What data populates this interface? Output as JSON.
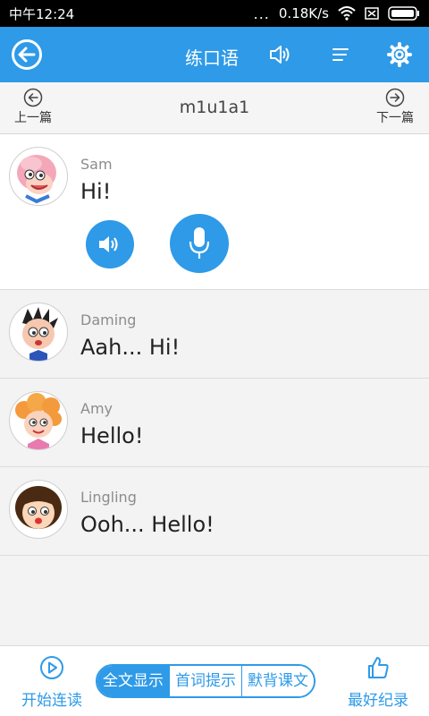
{
  "status_bar": {
    "time": "中午12:24",
    "dots": "...",
    "speed": "0.18K/s"
  },
  "app_bar": {
    "title": "练口语"
  },
  "lesson_nav": {
    "prev_label": "上一篇",
    "lesson_id": "m1u1a1",
    "next_label": "下一篇"
  },
  "dialogue": [
    {
      "speaker": "Sam",
      "text": "Hi!"
    },
    {
      "speaker": "Daming",
      "text": "Aah... Hi!"
    },
    {
      "speaker": "Amy",
      "text": "Hello!"
    },
    {
      "speaker": "Lingling",
      "text": "Ooh... Hello!"
    }
  ],
  "bottom_bar": {
    "start_label": "开始连读",
    "modes": [
      "全文显示",
      "首词提示",
      "默背课文"
    ],
    "selected_mode": "全文显示",
    "best_label": "最好纪录"
  },
  "colors": {
    "accent": "#2e9ae8",
    "status_bar": "#000000",
    "divider": "#dcdcdc"
  }
}
